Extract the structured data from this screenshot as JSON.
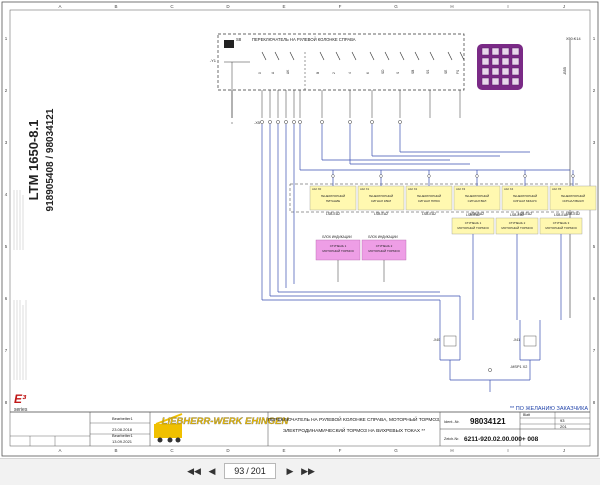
{
  "sheet": {
    "title_vertical": "LTM 1650-8.1",
    "numbers_vertical": "918905408 / 98034121",
    "switch_title": "ПЕРЕКЛЮЧАТЕЛЬ НА РУЛЕВОЙ КОЛОНКЕ СПРАВА",
    "switch_label": "S8",
    "lever_positions": [
      "0",
      "A",
      "AK",
      "B",
      "2",
      "4",
      "6",
      "SD",
      "S",
      "SB",
      "SS",
      "SE",
      "FS"
    ],
    "col_letters": [
      "A",
      "B",
      "C",
      "D",
      "E",
      "F",
      "G",
      "H",
      "I",
      "J"
    ],
    "row_numbers": [
      "1",
      "2",
      "3",
      "4",
      "5",
      "6",
      "7",
      "8"
    ],
    "connector_top": "X50:K14",
    "connector_bottom": "-B55",
    "left_marker": "-Y1",
    "fuse_marker": "-X5",
    "yellow_boxes": [
      {
        "ref": "A42 X0",
        "l1": "ГЕНЕРАТОРНЫЙ",
        "l2": "ПИТАНИЕ",
        "code": "LSB-EA2"
      },
      {
        "ref": "A42 X1",
        "l1": "ГЕНЕРАТОРНЫЙ",
        "l2": "СИГНАЛ 1ВКЛ",
        "code": "LSB-EA2"
      },
      {
        "ref": "A42 X2",
        "l1": "ГЕНЕРАТОРНЫЙ",
        "l2": "СИГНАЛ ПЛЮС",
        "code": "LSB-EA2"
      },
      {
        "ref": "A42 X3",
        "l1": "ГЕНЕРАТОРНЫЙ",
        "l2": "СИГНАЛ ВКЛ",
        "code": "LSB-EA2"
      },
      {
        "ref": "A42 X4",
        "l1": "ГЕНЕРАТОРНЫЙ",
        "l2": "СИГНАЛ МИНУС",
        "code": "LSB-EA2"
      },
      {
        "ref": "A42 X5",
        "l1": "ГЕНЕРАТОРНЫЙ",
        "l2": "СИГНАЛ ВЫКЛ",
        "code": "LSB-EA2"
      }
    ],
    "yellow_boxes_low": [
      {
        "ref": "A42 X6",
        "l1": "СТУПЕНЬ 1",
        "l2": "МОТОРНЫЙ ТОРМОЗ",
        "code": "LSB-EA2"
      },
      {
        "ref": "A42 X7",
        "l1": "СТУПЕНЬ 2",
        "l2": "МОТОРНЫЙ ТОРМОЗ",
        "code": "LSB-EA2"
      },
      {
        "ref": "A42 X8",
        "l1": "СТУПЕНЬ 3",
        "l2": "МОТОРНЫЙ ТОРМОЗ",
        "code": "LSB-EA2"
      }
    ],
    "pink_headers": [
      "БЛОК ИНДИКАЦИИ",
      "БЛОК ИНДИКАЦИИ"
    ],
    "pink_boxes": [
      {
        "l1": "СТУПЕНЬ 1",
        "l2": "МОТОРНЫЙ ТОРМОЗ"
      },
      {
        "l1": "СТУПЕНЬ 2",
        "l2": "МОТОРНЫЙ ТОРМОЗ"
      }
    ],
    "bottom_nodes": [
      "-X40",
      "-X41"
    ],
    "bottom_ref": "-MSP1 X2",
    "customer_note": "** ПО ЖЕЛАНИЮ ЗАКАЗЧИКА",
    "logo_series": "E3 series",
    "company": "LIEBHERR-WERK EHINGEN",
    "title_line1": "ПЕРЕКЛЮЧАТЕЛЬ НА РУЛЕВОЙ КОЛОНКЕ СПРАВА, МОТОРНЫЙ ТОРМОЗ,",
    "title_line2": "ЭЛЕКТРОДИНАМИЧЕСКИЙ ТОРМОЗ НА ВИХРЕВЫХ ТОКАХ **",
    "ident_label": "Ident.-Nr.",
    "ident_value": "98034121",
    "zeich_label": "Zeich-Nr.",
    "zeich_value": "6211-920.02.00.000+ 008",
    "page_label": "Blatt",
    "page_value": "93",
    "pages_value": "201",
    "date1": "23.08.2018",
    "date2": "13.09.2021",
    "name1": "Bearbeiter1",
    "name2": "Bearbeiter1",
    "name3": "Bearbeiter1"
  },
  "toolbar": {
    "current_page": "93",
    "separator": "/",
    "total_pages": "201"
  },
  "colors": {
    "wire_blue": "#3a4fb0",
    "wire_dark": "#333333",
    "yellow_box": "#fff8b0",
    "pink_box": "#ee9ee6",
    "purple_connector": "#7a2a86",
    "logo_yellow": "#f0c000",
    "note_blue": "#2244aa"
  }
}
